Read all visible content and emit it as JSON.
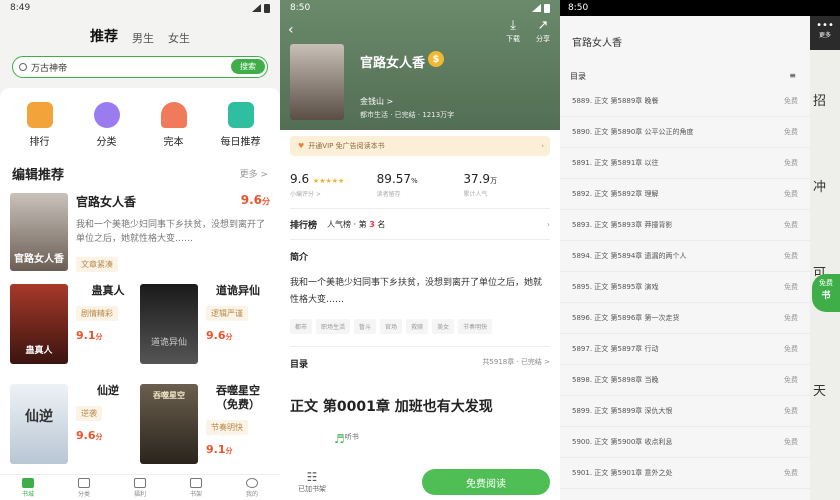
{
  "panel1": {
    "time": "8:49",
    "tabs": [
      "推荐",
      "男生",
      "女生"
    ],
    "search_placeholder": "万古神帝",
    "search_button": "搜索",
    "categories": [
      {
        "label": "排行",
        "color": "#f2a33a"
      },
      {
        "label": "分类",
        "color": "#9b7cf0"
      },
      {
        "label": "完本",
        "color": "#f07a5a"
      },
      {
        "label": "每日推荐",
        "color": "#2fbfa0"
      }
    ],
    "section_title": "编辑推荐",
    "section_more": "更多 >",
    "featured": {
      "title": "官路女人香",
      "score": "9.6",
      "score_unit": "分",
      "desc": "我和一个美艳少妇同事下乡扶贫，没想到离开了单位之后，她就性格大变……",
      "tag": "文章紧凑",
      "cover_text": "官路女人香"
    },
    "grid": [
      {
        "title": "蛊真人",
        "tag": "剧情精彩",
        "score": "9.1",
        "unit": "分",
        "cover_color": "#7a2a1a",
        "cover_text": "蛊真人"
      },
      {
        "title": "道诡异仙",
        "tag": "逻辑严谨",
        "score": "9.6",
        "unit": "分",
        "cover_color": "#2c2c2c",
        "cover_text": "道诡异仙"
      },
      {
        "title": "仙逆",
        "tag": "逆袭",
        "score": "9.6",
        "unit": "分",
        "cover_color": "#dfe6ee",
        "cover_text": "仙逆"
      },
      {
        "title": "吞噬星空（免费）",
        "tag": "节奏明快",
        "score": "9.1",
        "unit": "分",
        "cover_color": "#4a4033",
        "cover_text": "吞噬星空"
      }
    ],
    "nav": [
      "书城",
      "分类",
      "福利",
      "书架",
      "我的"
    ]
  },
  "panel2": {
    "time": "8:50",
    "actions": [
      {
        "icon": "⤓",
        "label": "下载"
      },
      {
        "icon": "↗",
        "label": "分享"
      }
    ],
    "title": "官路女人香",
    "coin": "$",
    "author": "金钱山 >",
    "meta": "都市生活 · 已完结 · 1213万字",
    "vip_text": "开通VIP 免广告阅读本书",
    "stats": [
      {
        "value": "9.6",
        "unit": "",
        "label": "小编评分 >",
        "stars": "★★★★★"
      },
      {
        "value": "89.57",
        "unit": "%",
        "label": "读者留存",
        "stars": ""
      },
      {
        "value": "37.9",
        "unit": "万",
        "label": "累计人气",
        "stars": ""
      }
    ],
    "rank_label": "排行榜",
    "rank_text_pre": "人气榜 · 第",
    "rank_num": "3",
    "rank_text_post": "名",
    "rank_arrow": "›",
    "intro_title": "简介",
    "intro": "我和一个美艳少妇同事下乡扶贫，没想到离开了单位之后，她就性格大变……",
    "keywords": [
      "都市",
      "职场生活",
      "暂斗",
      "官场",
      "救赎",
      "美女",
      "节奏明快"
    ],
    "toc_title": "目录",
    "toc_info": "共5918章 · 已完结 >",
    "first_chapter": "正文 第0001章 加班也有大发现",
    "bottom": [
      {
        "icon": "☷",
        "label": "已加书架"
      },
      {
        "icon": "♬",
        "label": "听书"
      }
    ],
    "read_button": "免费阅读"
  },
  "panel3": {
    "time": "8:50",
    "title": "官路女人香",
    "toc_label": "目录",
    "sort_icon": "≡",
    "chapters": [
      {
        "name": "5889. 正文 第5889章 晚餐",
        "tag": "免费"
      },
      {
        "name": "5890. 正文 第5890章 公平公正的角度",
        "tag": "免费"
      },
      {
        "name": "5891. 正文 第5891章 以往",
        "tag": "免费"
      },
      {
        "name": "5892. 正文 第5892章 理解",
        "tag": "免费"
      },
      {
        "name": "5893. 正文 第5893章 莽撞背影",
        "tag": "免费"
      },
      {
        "name": "5894. 正文 第5894章 遗漏的两个人",
        "tag": "免费"
      },
      {
        "name": "5895. 正文 第5895章 演戏",
        "tag": "免费"
      },
      {
        "name": "5896. 正文 第5896章 第一次走货",
        "tag": "免费"
      },
      {
        "name": "5897. 正文 第5897章 行动",
        "tag": "免费"
      },
      {
        "name": "5898. 正文 第5898章 当晚",
        "tag": "免费"
      },
      {
        "name": "5899. 正文 第5899章 深仇大恨",
        "tag": "免费"
      },
      {
        "name": "5900. 正文 第5900章 收点利息",
        "tag": "免费"
      },
      {
        "name": "5901. 正文 第5901章 意外之处",
        "tag": "免费"
      }
    ],
    "bg_chars": [
      "招",
      "冲",
      "可",
      "书",
      "天"
    ],
    "more_label": "更多",
    "free_badge": "免费"
  }
}
